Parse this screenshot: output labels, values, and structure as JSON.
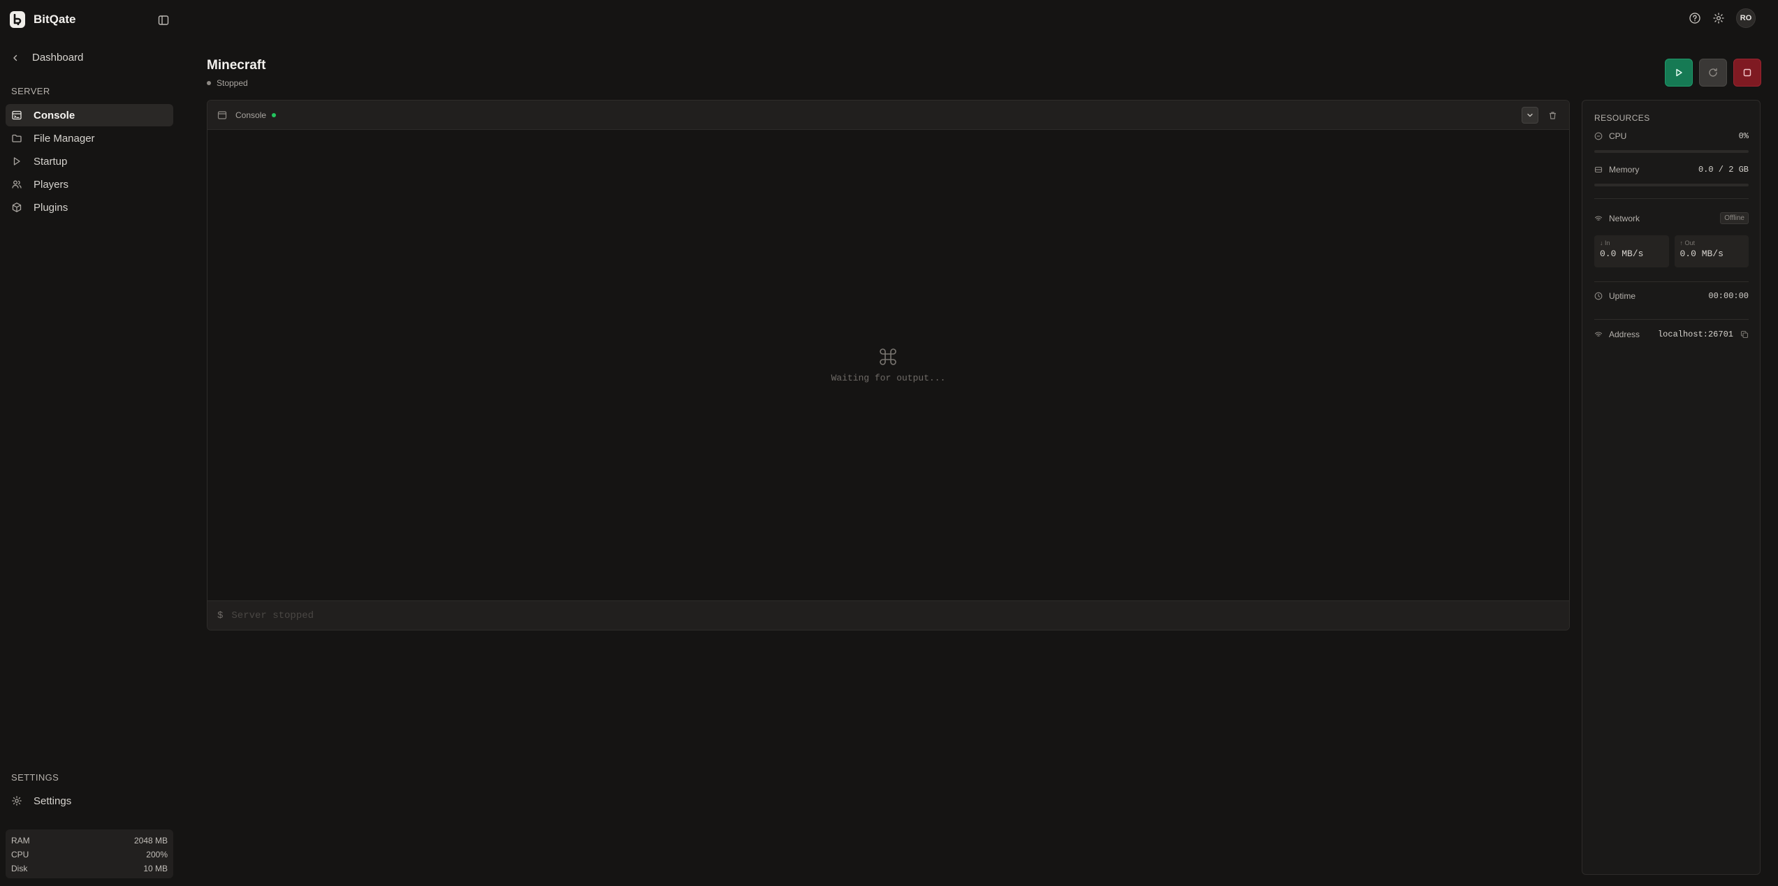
{
  "app": {
    "name": "BitQate"
  },
  "nav": {
    "back_label": "Dashboard",
    "server_section": "SERVER",
    "items": [
      {
        "label": "Console",
        "icon": "console-icon",
        "active": true
      },
      {
        "label": "File Manager",
        "icon": "folder-icon",
        "active": false
      },
      {
        "label": "Startup",
        "icon": "play-icon",
        "active": false
      },
      {
        "label": "Players",
        "icon": "users-icon",
        "active": false
      },
      {
        "label": "Plugins",
        "icon": "package-icon",
        "active": false
      }
    ],
    "settings_section": "SETTINGS",
    "settings_label": "Settings"
  },
  "system": {
    "ram_label": "RAM",
    "ram_value": "2048 MB",
    "cpu_label": "CPU",
    "cpu_value": "200%",
    "disk_label": "Disk",
    "disk_value": "10 MB"
  },
  "user": {
    "initials": "RO"
  },
  "server": {
    "name": "Minecraft",
    "status": "Stopped"
  },
  "console": {
    "title": "Console",
    "waiting_text": "Waiting for output...",
    "prompt": "$",
    "input_placeholder": "Server stopped"
  },
  "resources": {
    "title": "RESOURCES",
    "cpu_label": "CPU",
    "cpu_value": "0%",
    "cpu_fraction": 0,
    "memory_label": "Memory",
    "memory_value": "0.0 / 2 GB",
    "memory_fraction": 0,
    "network_label": "Network",
    "network_badge": "Offline",
    "in_label": "↓ In",
    "in_value": "0.0 MB/s",
    "out_label": "↑ Out",
    "out_value": "0.0 MB/s",
    "uptime_label": "Uptime",
    "uptime_value": "00:00:00",
    "address_label": "Address",
    "address_value": "localhost:26701"
  },
  "colors": {
    "background": "#151413",
    "accent_start": "#167a54",
    "accent_stop": "#7f1a22",
    "live_indicator": "#22c55e"
  }
}
